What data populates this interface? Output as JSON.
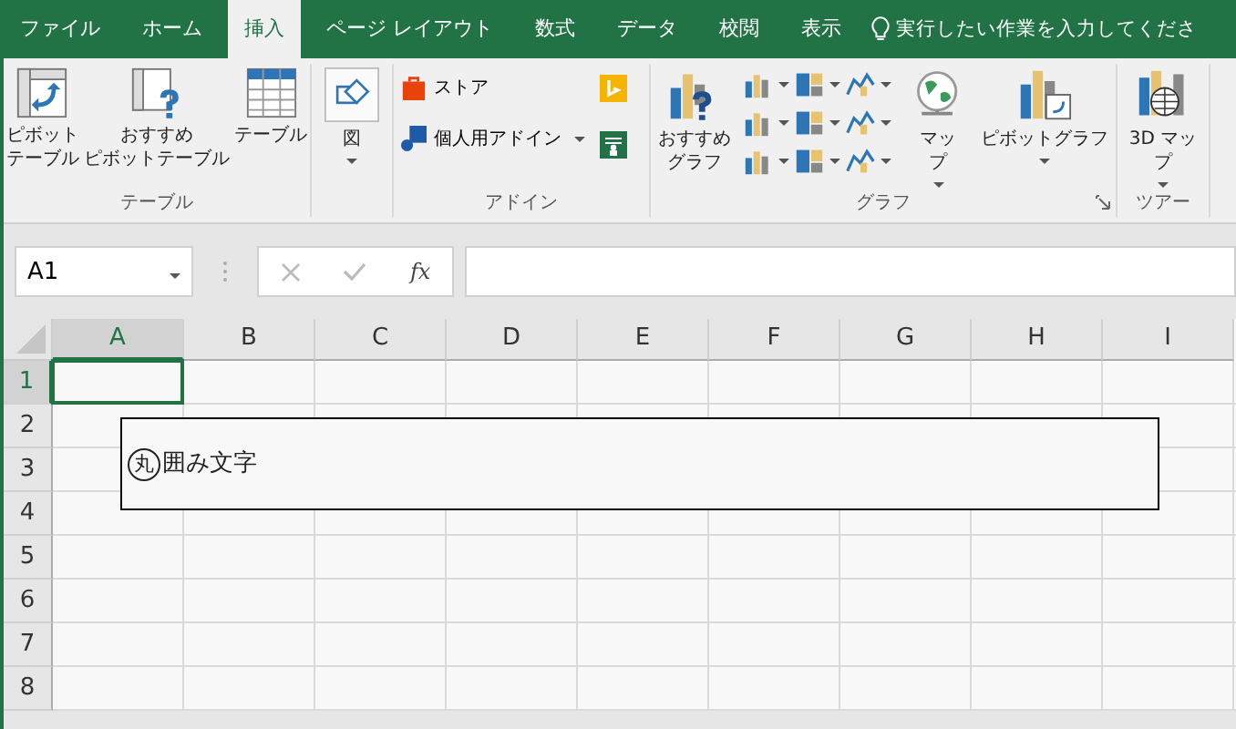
{
  "tabs": [
    {
      "label": "ファイル",
      "selected": false
    },
    {
      "label": "ホーム",
      "selected": false
    },
    {
      "label": "挿入",
      "selected": true
    },
    {
      "label": "ページ レイアウト",
      "selected": false
    },
    {
      "label": "数式",
      "selected": false
    },
    {
      "label": "データ",
      "selected": false
    },
    {
      "label": "校閲",
      "selected": false
    },
    {
      "label": "表示",
      "selected": false
    }
  ],
  "tell_me": {
    "placeholder": "実行したい作業を入力してくださ"
  },
  "ribbon": {
    "groups": [
      {
        "label": "テーブル",
        "buttons": [
          {
            "lines": [
              "ピボット",
              "テーブル"
            ]
          },
          {
            "lines": [
              "おすすめ",
              "ピボットテーブル"
            ]
          },
          {
            "lines": [
              "テーブル"
            ]
          }
        ]
      },
      {
        "buttons": [
          {
            "lines": [
              "図"
            ],
            "dropdown": true
          }
        ]
      },
      {
        "label": "アドイン",
        "buttons": [
          {
            "lines": [
              "ストア"
            ]
          },
          {
            "lines": [
              "個人用アドイン"
            ],
            "dropdown": true
          }
        ]
      },
      {
        "label": "グラフ",
        "buttons": [
          {
            "lines": [
              "おすすめ",
              "グラフ"
            ]
          },
          {
            "lines": [
              "マッ",
              "プ"
            ],
            "dropdown": true
          },
          {
            "lines": [
              "ピボットグラフ"
            ],
            "dropdown": true
          }
        ]
      },
      {
        "label": "ツアー",
        "buttons": [
          {
            "lines": [
              "3D マッ",
              "プ"
            ],
            "dropdown": true
          }
        ]
      }
    ]
  },
  "name_box": {
    "value": "A1"
  },
  "formula_bar": {
    "function_label": "fx"
  },
  "sheet": {
    "columns": [
      {
        "label": "A",
        "selected": true
      },
      {
        "label": "B",
        "selected": false
      },
      {
        "label": "C",
        "selected": false
      },
      {
        "label": "D",
        "selected": false
      },
      {
        "label": "E",
        "selected": false
      },
      {
        "label": "F",
        "selected": false
      },
      {
        "label": "G",
        "selected": false
      },
      {
        "label": "H",
        "selected": false
      },
      {
        "label": "I",
        "selected": false
      }
    ],
    "rows": [
      {
        "label": "1",
        "selected": true
      },
      {
        "label": "2",
        "selected": false
      },
      {
        "label": "3",
        "selected": false
      },
      {
        "label": "4",
        "selected": false
      },
      {
        "label": "5",
        "selected": false
      },
      {
        "label": "6",
        "selected": false
      },
      {
        "label": "7",
        "selected": false
      },
      {
        "label": "8",
        "selected": false
      }
    ]
  },
  "text_box": {
    "enclosed_character": "丸",
    "text": "囲み文字"
  }
}
